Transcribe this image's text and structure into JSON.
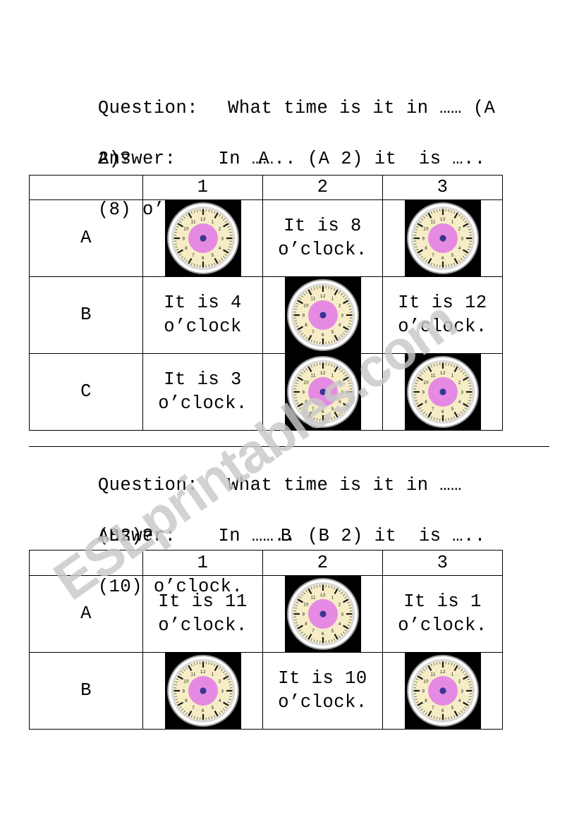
{
  "watermark": {
    "text": "ESLprintables.com",
    "color": "#c9c9c9"
  },
  "colors": {
    "clock_face": "#f6edc6",
    "clock_center": "#e58ae2",
    "clock_hub": "#3a3591",
    "clock_rim": "#d8d8d8",
    "clock_bg": "#000000",
    "ink": "#000000"
  },
  "sections": [
    {
      "id": "A",
      "question_label": "Question:",
      "question_text": "What time is it in …… (A 2)?",
      "question_line1": "What time is it in …… (A",
      "question_line2": "2)?",
      "question_hint": "A",
      "answer_label": "Answer:",
      "answer_text": "In …….. (A 2) it  is …..  (8) o’clock.",
      "answer_line1": "In …….. (A 2) it  is …..",
      "answer_line2": "(8) o’clock.",
      "table": {
        "columns": [
          "",
          "1",
          "2",
          "3"
        ],
        "rows": [
          {
            "label": "A",
            "cells": [
              {
                "type": "clock"
              },
              {
                "type": "text",
                "text": "It is 8 o’clock."
              },
              {
                "type": "clock"
              }
            ]
          },
          {
            "label": "B",
            "cells": [
              {
                "type": "text",
                "text": "It is 4 o’clock"
              },
              {
                "type": "clock"
              },
              {
                "type": "text",
                "text": "It is 12 o’clock."
              }
            ]
          },
          {
            "label": "C",
            "cells": [
              {
                "type": "text",
                "text": "It is 3 o’clock."
              },
              {
                "type": "clock"
              },
              {
                "type": "clock"
              }
            ]
          }
        ]
      }
    },
    {
      "id": "B",
      "question_label": "Question:",
      "question_text": "What time is it in …… (B2)?",
      "question_line1": "What time is it in ……",
      "question_line2": "(B2)?",
      "question_hint": "B",
      "answer_label": "Answer:",
      "answer_text": "In …….. (B 2) it  is …..  (10) o’clock.",
      "answer_line1": "In …….. (B 2) it  is …..",
      "answer_line2": "(10) o’clock.",
      "table": {
        "columns": [
          "",
          "1",
          "2",
          "3"
        ],
        "rows": [
          {
            "label": "A",
            "cells": [
              {
                "type": "text",
                "text": "It is 11 o’clock."
              },
              {
                "type": "clock"
              },
              {
                "type": "text",
                "text": "It is 1 o’clock."
              }
            ]
          },
          {
            "label": "B",
            "cells": [
              {
                "type": "clock"
              },
              {
                "type": "text",
                "text": "It is 10 o’clock."
              },
              {
                "type": "clock"
              }
            ]
          }
        ]
      }
    }
  ],
  "clock_face": {
    "numerals": [
      "12",
      "1",
      "2",
      "3",
      "4",
      "5",
      "6",
      "7",
      "8",
      "9",
      "10",
      "11"
    ],
    "has_hands": false
  }
}
